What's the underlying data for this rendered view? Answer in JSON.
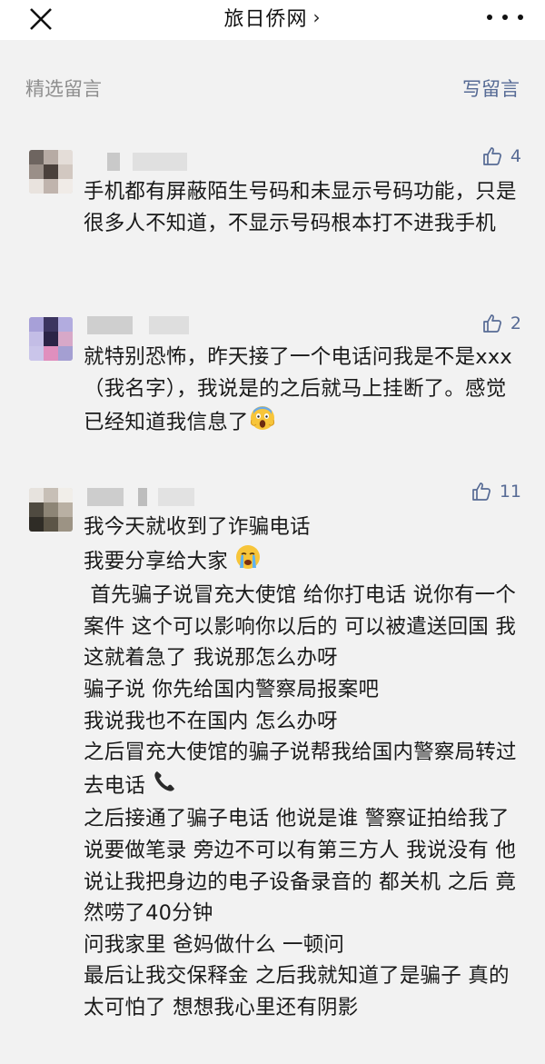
{
  "header": {
    "title": "旅日侨网",
    "chevron": "›",
    "close_icon": "close-icon",
    "more_icon": "more-dots-icon"
  },
  "section": {
    "title": "精选留言",
    "write_label": "写留言"
  },
  "colors": {
    "link": "#576b95",
    "muted": "#8e8e8e",
    "background": "#f2f2f2"
  },
  "comments": [
    {
      "likes": "4",
      "text": "手机都有屏蔽陌生号码和未显示号码功能，只是很多人不知道，不显示号码根本打不进我手机"
    },
    {
      "likes": "2",
      "text": "就特别恐怖，昨天接了一个电话问我是不是xxx（我名字），我说是的之后就马上挂断了。感觉已经知道我信息了"
    },
    {
      "likes": "11",
      "lines": [
        "我今天就收到了诈骗电话",
        "我要分享给大家",
        " 首先骗子说冒充大使馆 给你打电话 说你有一个案件 这个可以影响你以后的 可以被遣送回国 我这就着急了 我说那怎么办呀",
        "骗子说 你先给国内警察局报案吧",
        "我说我也不在国内 怎么办呀",
        "之后冒充大使馆的骗子说帮我给国内警察局转过去电话",
        "之后接通了骗子电话 他说是谁 警察证拍给我了 说要做笔录 旁边不可以有第三方人 我说没有 他说让我把身边的电子设备录音的 都关机 之后 竟然唠了40分钟",
        "问我家里 爸妈做什么 一顿问",
        "最后让我交保释金 之后我就知道了是骗子 真的太可怕了 想想我心里还有阴影"
      ]
    }
  ]
}
